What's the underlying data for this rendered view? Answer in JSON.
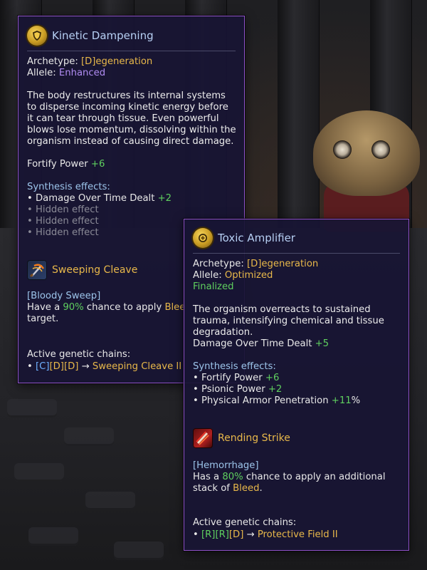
{
  "panels": [
    {
      "title": "Kinetic Dampening",
      "icon": "shield-icon",
      "archetype_label": "Archetype:",
      "archetype_value": "[D]egeneration",
      "allele_label": "Allele:",
      "allele_value": "Enhanced",
      "description": "The body restructures its internal systems to disperse incoming kinetic energy before it can tear through tissue. Even powerful blows lose momentum, dissolving within the organism instead of causing direct damage.",
      "stat_label": "Fortify Power",
      "stat_value": "+6",
      "synthesis_heading": "Synthesis effects:",
      "synthesis": [
        {
          "bullet": "•",
          "label": "Damage Over Time Dealt",
          "value": "+2"
        },
        {
          "bullet": "•",
          "label": "Hidden effect",
          "value": ""
        },
        {
          "bullet": "•",
          "label": "Hidden effect",
          "value": ""
        },
        {
          "bullet": "•",
          "label": "Hidden effect",
          "value": ""
        }
      ],
      "skill": {
        "icon": "sweep-icon",
        "name": "Sweeping Cleave",
        "tag": "[Bloody Sweep]",
        "line1_pre": "Have a",
        "line1_pct": "90%",
        "line1_post": "chance to apply",
        "line1_tail": "Blee",
        "line2": "target."
      },
      "chains_heading": "Active genetic chains:",
      "chain": {
        "bullet": "•",
        "g1": "[C]",
        "g2": "[D]",
        "g3": "[D]",
        "arrow": "→",
        "result": "Sweeping Cleave II"
      }
    },
    {
      "title": "Toxic Amplifier",
      "icon": "shield-icon",
      "archetype_label": "Archetype:",
      "archetype_value": "[D]egeneration",
      "allele_label": "Allele:",
      "allele_value": "Optimized",
      "status": "Finalized",
      "description": "The organism overreacts to sustained trauma, intensifying chemical and tissue degradation.",
      "stat_label": "Damage Over Time Dealt",
      "stat_value": "+5",
      "synthesis_heading": "Synthesis effects:",
      "synthesis": [
        {
          "bullet": "•",
          "label": "Fortify Power",
          "value": "+6",
          "suffix": ""
        },
        {
          "bullet": "•",
          "label": "Psionic Power",
          "value": "+2",
          "suffix": ""
        },
        {
          "bullet": "•",
          "label": "Physical Armor Penetration",
          "value": "+11",
          "suffix": "%"
        }
      ],
      "skill": {
        "icon": "rending-icon",
        "name": "Rending Strike",
        "tag": "[Hemorrhage]",
        "line1_pre": "Has a",
        "line1_pct": "80%",
        "line1_post": "chance to apply an additional",
        "line2_pre": "stack of",
        "line2_keyword": "Bleed",
        "line2_post": "."
      },
      "chains_heading": "Active genetic chains:",
      "chain": {
        "bullet": "•",
        "g1": "[R]",
        "g2": "[R]",
        "g3": "[D]",
        "arrow": "→",
        "result": "Protective Field II"
      }
    }
  ],
  "colors": {
    "border": "#8f52c8",
    "gold": "#e8b84a",
    "green": "#5fd05f",
    "purple": "#b08cf2",
    "blue": "#6fb0ff"
  }
}
